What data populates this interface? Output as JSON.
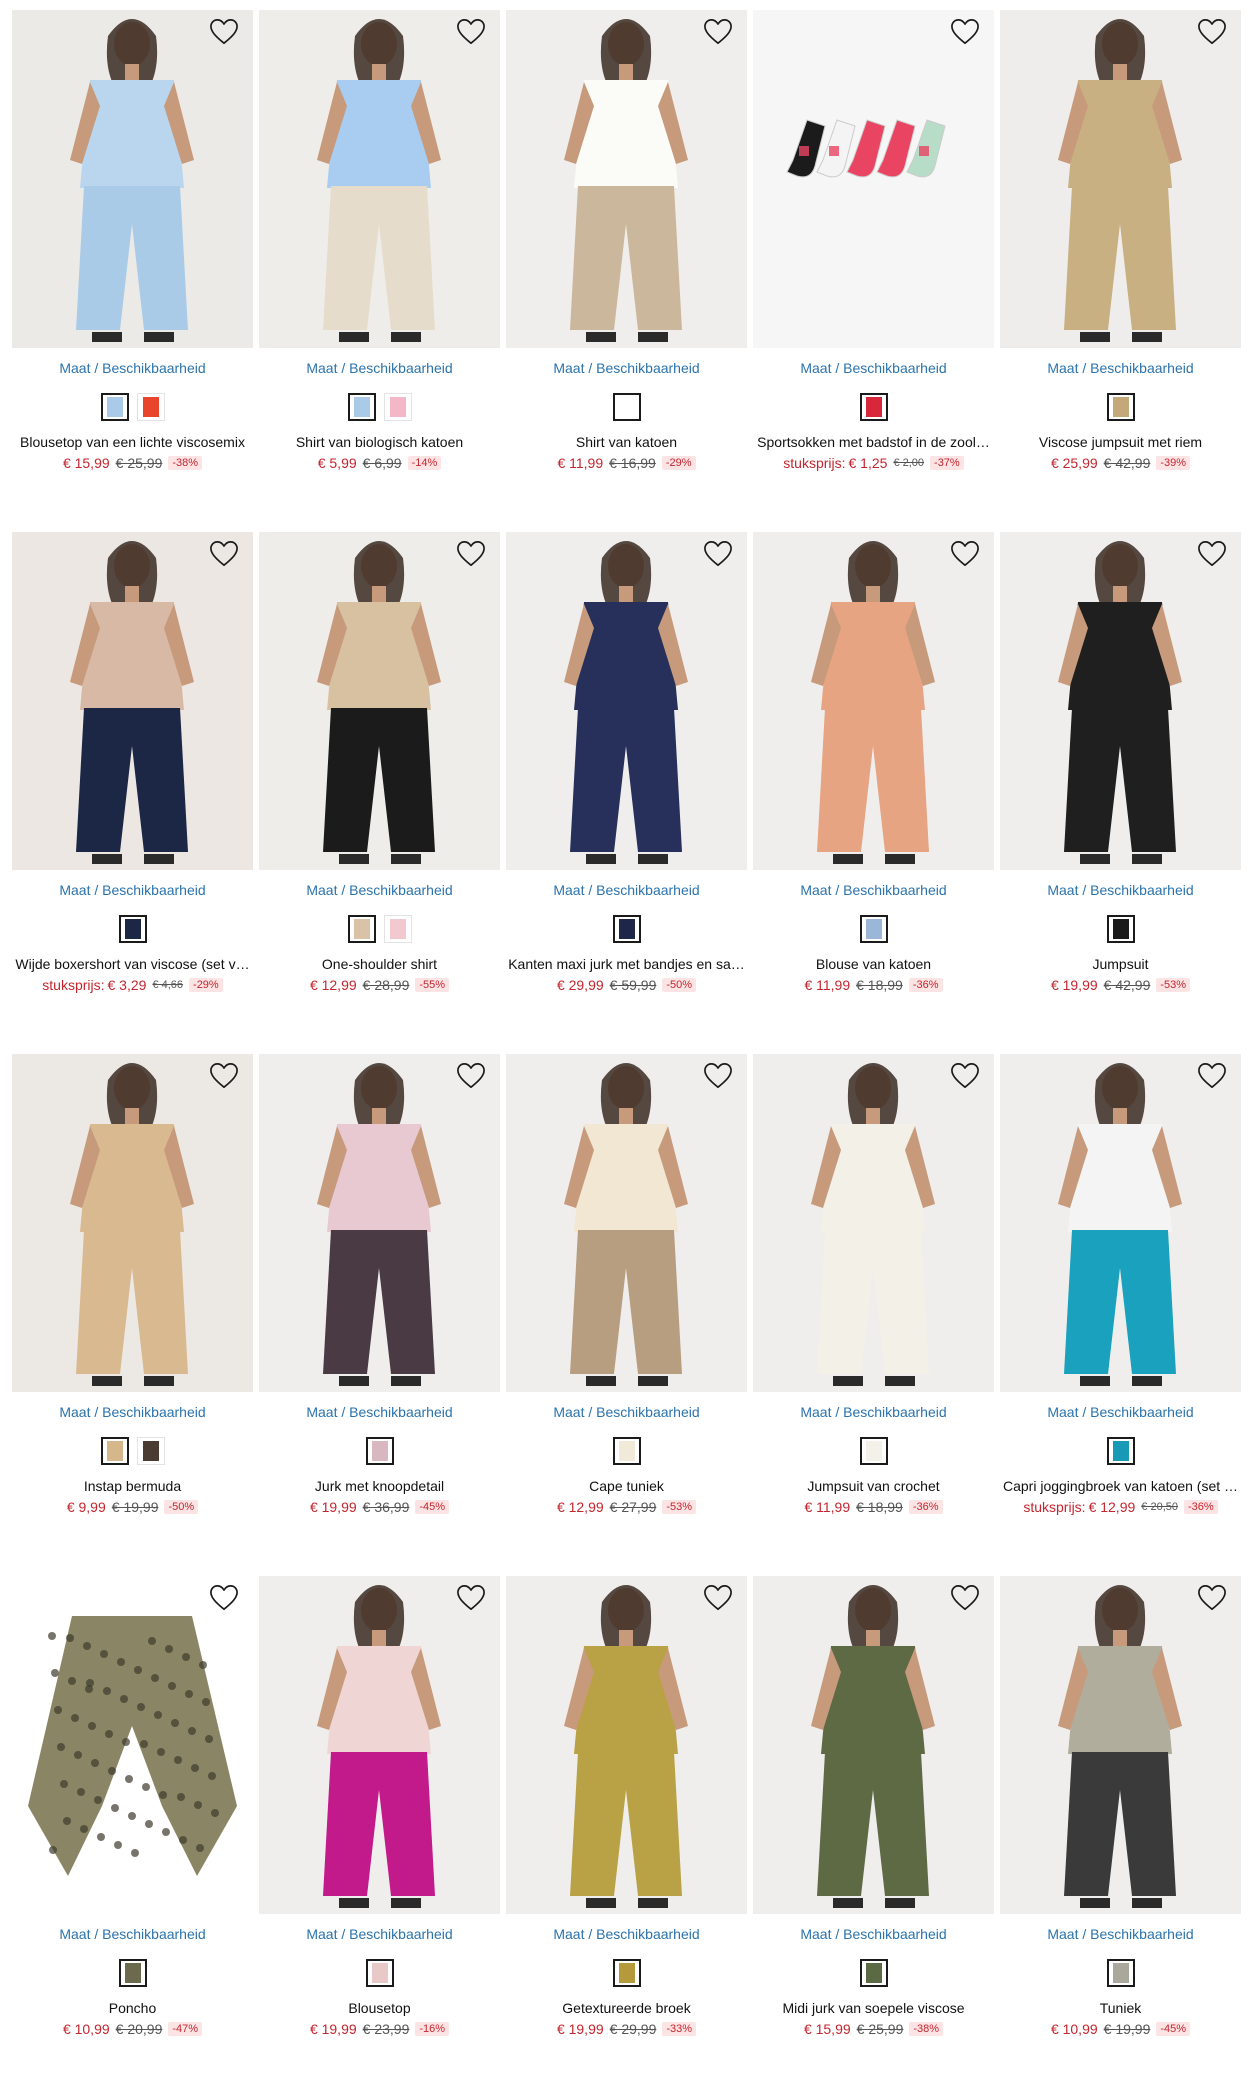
{
  "products": [
    {
      "title": "Blousetop van een lichte viscosemix",
      "size_link": "Maat / Beschikbaarheid",
      "unit_label": "",
      "price": "€ 15,99",
      "old_price": "€ 25,99",
      "discount": "-38%",
      "image": "model-in-light-blue-blouse-and-shorts",
      "bg": "#eceae6",
      "swatches": [
        "#a9cbe8",
        "#e8452c"
      ],
      "garment": "#b9d6ee",
      "bottom": "#a9cbe8"
    },
    {
      "title": "Shirt van biologisch katoen",
      "size_link": "Maat / Beschikbaarheid",
      "unit_label": "",
      "price": "€ 5,99",
      "old_price": "€ 6,99",
      "discount": "-14%",
      "image": "model-in-light-blue-cropped-shirt",
      "bg": "#eeede9",
      "swatches": [
        "#a9cbe8",
        "#f3b7c7"
      ],
      "garment": "#a8cdf0",
      "bottom": "#e6dccb"
    },
    {
      "title": "Shirt van katoen",
      "size_link": "Maat / Beschikbaarheid",
      "unit_label": "",
      "price": "€ 11,99",
      "old_price": "€ 16,99",
      "discount": "-29%",
      "image": "model-in-white-cotton-shirt",
      "bg": "#efeeec",
      "swatches": [
        "#ffffff"
      ],
      "garment": "#fbfbf8",
      "bottom": "#cbb89c"
    },
    {
      "title": "Sportsokken met badstof in de zool…",
      "size_link": "Maat / Beschikbaarheid",
      "unit_label": "stuksprijs:",
      "price": "€ 1,25",
      "old_price": "€ 2,00",
      "discount": "-37%",
      "image": "five-pairs-of-sport-socks",
      "bg": "#f6f6f6",
      "swatches": [
        "#d8263a"
      ],
      "garment": "#e94563",
      "bottom": "#f6f6f6"
    },
    {
      "title": "Viscose jumpsuit met riem",
      "size_link": "Maat / Beschikbaarheid",
      "unit_label": "",
      "price": "€ 25,99",
      "old_price": "€ 42,99",
      "discount": "-39%",
      "image": "model-in-beige-jumpsuit-with-belt",
      "bg": "#eeedeb",
      "swatches": [
        "#c3a97a"
      ],
      "garment": "#c9b083",
      "bottom": "#c9b083"
    },
    {
      "title": "Wijde boxershort van viscose (set v…",
      "size_link": "Maat / Beschikbaarheid",
      "unit_label": "stuksprijs:",
      "price": "€ 3,29",
      "old_price": "€ 4,66",
      "discount": "-29%",
      "image": "navy-boxer-shorts-with-lace",
      "bg": "#ece7e2",
      "swatches": [
        "#1c2645"
      ],
      "garment": "#d8b9a6",
      "bottom": "#1c2645"
    },
    {
      "title": "One-shoulder shirt",
      "size_link": "Maat / Beschikbaarheid",
      "unit_label": "",
      "price": "€ 12,99",
      "old_price": "€ 28,99",
      "discount": "-55%",
      "image": "model-in-beige-one-shoulder-shirt",
      "bg": "#efedea",
      "swatches": [
        "#d9c2a6",
        "#f1c9cf"
      ],
      "garment": "#d8c1a1",
      "bottom": "#1b1b1b"
    },
    {
      "title": "Kanten maxi jurk met bandjes en sa…",
      "size_link": "Maat / Beschikbaarheid",
      "unit_label": "",
      "price": "€ 29,99",
      "old_price": "€ 59,99",
      "discount": "-50%",
      "image": "model-in-navy-lace-maxi-dress",
      "bg": "#efeeec",
      "swatches": [
        "#1e2747"
      ],
      "garment": "#26305a",
      "bottom": "#26305a"
    },
    {
      "title": "Blouse van katoen",
      "size_link": "Maat / Beschikbaarheid",
      "unit_label": "",
      "price": "€ 11,99",
      "old_price": "€ 18,99",
      "discount": "-36%",
      "image": "model-in-striped-cotton-blouse",
      "bg": "#efeeec",
      "swatches": [
        "#9bb7d8"
      ],
      "garment": "#e7a482",
      "bottom": "#e7a482"
    },
    {
      "title": "Jumpsuit",
      "size_link": "Maat / Beschikbaarheid",
      "unit_label": "",
      "price": "€ 19,99",
      "old_price": "€ 42,99",
      "discount": "-53%",
      "image": "model-in-black-jumpsuit",
      "bg": "#efeeec",
      "swatches": [
        "#1b1b1b"
      ],
      "garment": "#1f1f1f",
      "bottom": "#1f1f1f"
    },
    {
      "title": "Instap bermuda",
      "size_link": "Maat / Beschikbaarheid",
      "unit_label": "",
      "price": "€ 9,99",
      "old_price": "€ 19,99",
      "discount": "-50%",
      "image": "model-in-leaf-print-bermuda",
      "bg": "#ece9e4",
      "swatches": [
        "#d6b78c",
        "#4a3b33"
      ],
      "garment": "#d9b990",
      "bottom": "#d9b990"
    },
    {
      "title": "Jurk met knoopdetail",
      "size_link": "Maat / Beschikbaarheid",
      "unit_label": "",
      "price": "€ 19,99",
      "old_price": "€ 36,99",
      "discount": "-45%",
      "image": "model-in-ombre-maxi-dress",
      "bg": "#efeeec",
      "swatches": [
        "#d9b7c0"
      ],
      "garment": "#e8c9d2",
      "bottom": "#4a3a44"
    },
    {
      "title": "Cape tuniek",
      "size_link": "Maat / Beschikbaarheid",
      "unit_label": "",
      "price": "€ 12,99",
      "old_price": "€ 27,99",
      "discount": "-53%",
      "image": "model-in-cream-cape-tunic",
      "bg": "#efeeec",
      "swatches": [
        "#f2ead8"
      ],
      "garment": "#f1e7d2",
      "bottom": "#b89e80"
    },
    {
      "title": "Jumpsuit van crochet",
      "size_link": "Maat / Beschikbaarheid",
      "unit_label": "",
      "price": "€ 11,99",
      "old_price": "€ 18,99",
      "discount": "-36%",
      "image": "model-in-white-crochet-jumpsuit",
      "bg": "#efeeec",
      "swatches": [
        "#f4f1ea"
      ],
      "garment": "#f3f0e8",
      "bottom": "#f3f0e8"
    },
    {
      "title": "Capri joggingbroek van katoen (set …",
      "size_link": "Maat / Beschikbaarheid",
      "unit_label": "stuksprijs:",
      "price": "€ 12,99",
      "old_price": "€ 20,50",
      "discount": "-36%",
      "image": "model-in-turquoise-capri-joggers",
      "bg": "#efeeec",
      "swatches": [
        "#1899b5"
      ],
      "garment": "#f4f4f4",
      "bottom": "#1aa1bd"
    },
    {
      "title": "Poncho",
      "size_link": "Maat / Beschikbaarheid",
      "unit_label": "",
      "price": "€ 10,99",
      "old_price": "€ 20,99",
      "discount": "-47%",
      "image": "patterned-poncho",
      "bg": "#ffffff",
      "swatches": [
        "#6b6a4c"
      ],
      "garment": "#8a8564",
      "bottom": "#ffffff"
    },
    {
      "title": "Blousetop",
      "size_link": "Maat / Beschikbaarheid",
      "unit_label": "",
      "price": "€ 19,99",
      "old_price": "€ 23,99",
      "discount": "-16%",
      "image": "model-in-floral-blouse-and-pink-trousers",
      "bg": "#efeeec",
      "swatches": [
        "#e8c9c8"
      ],
      "garment": "#efd6d4",
      "bottom": "#c2198b"
    },
    {
      "title": "Getextureerde broek",
      "size_link": "Maat / Beschikbaarheid",
      "unit_label": "",
      "price": "€ 19,99",
      "old_price": "€ 29,99",
      "discount": "-33%",
      "image": "model-in-mustard-textured-trousers",
      "bg": "#efeeec",
      "swatches": [
        "#b49a3a"
      ],
      "garment": "#b9a245",
      "bottom": "#b9a245"
    },
    {
      "title": "Midi jurk van soepele viscose",
      "size_link": "Maat / Beschikbaarheid",
      "unit_label": "",
      "price": "€ 15,99",
      "old_price": "€ 25,99",
      "discount": "-38%",
      "image": "model-in-patterned-midi-dress",
      "bg": "#efeeec",
      "swatches": [
        "#5c6a43"
      ],
      "garment": "#5e6a44",
      "bottom": "#5e6a44"
    },
    {
      "title": "Tuniek",
      "size_link": "Maat / Beschikbaarheid",
      "unit_label": "",
      "price": "€ 10,99",
      "old_price": "€ 19,99",
      "discount": "-45%",
      "image": "model-in-patterned-tunic",
      "bg": "#efeeec",
      "swatches": [
        "#a9a89a"
      ],
      "garment": "#b0ad9c",
      "bottom": "#3a3a3a"
    }
  ],
  "colors": {
    "link": "#2b73ad",
    "sale": "#c3262f",
    "discount_bg": "#fde4e4"
  },
  "icons": {
    "favorite": "heart-outline-icon"
  }
}
